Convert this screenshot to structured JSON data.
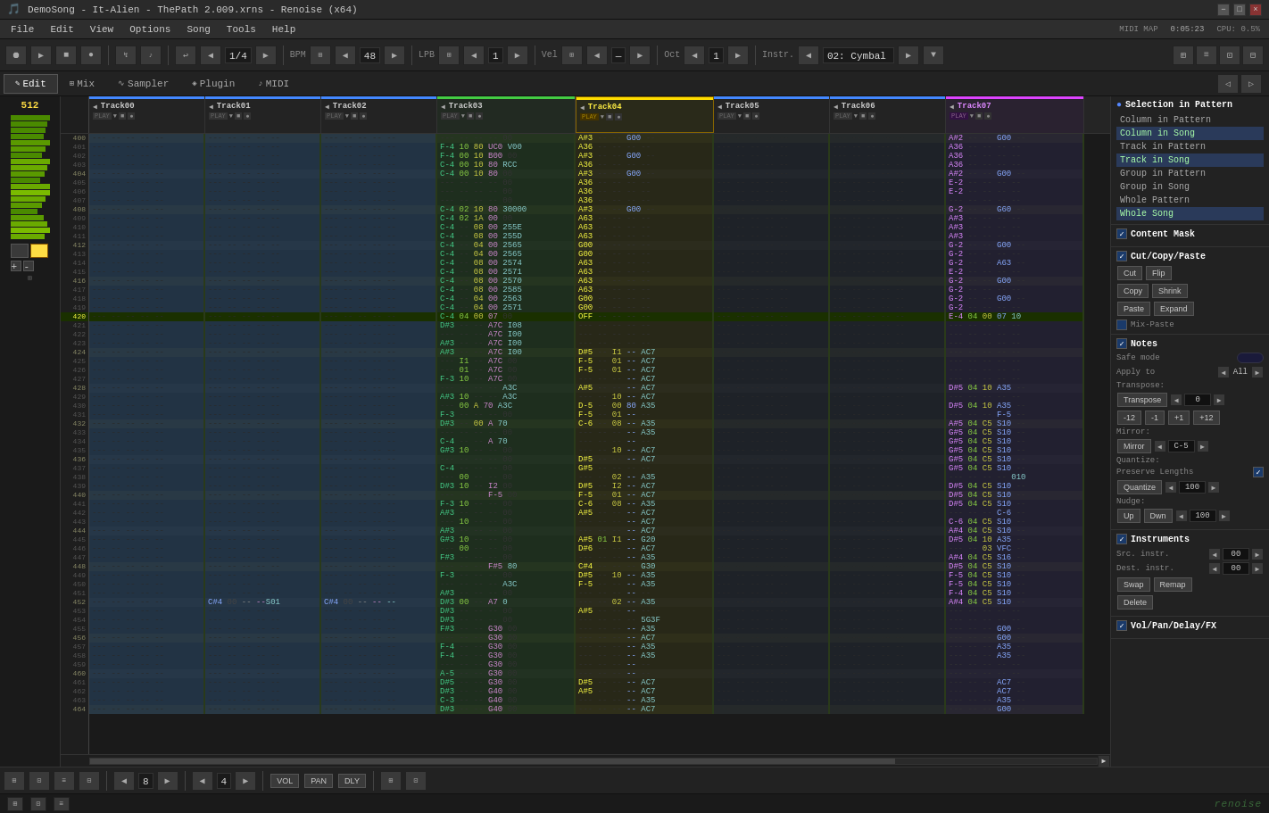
{
  "titlebar": {
    "title": "DemoSong - It-Alien - ThePath 2.009.xrns - Renoise (x64)",
    "min": "−",
    "max": "□",
    "close": "×"
  },
  "menu": {
    "items": [
      "File",
      "Edit",
      "View",
      "Options",
      "Song",
      "Tools",
      "Help"
    ]
  },
  "toolbar": {
    "bpm_label": "BPM",
    "bpm_val": "48",
    "lpb_label": "LPB",
    "lpb_val": "1",
    "vel_label": "Vel",
    "vel_val": "—",
    "oct_label": "Oct",
    "oct_val": "1",
    "instr_label": "Instr.",
    "instr_val": "02: Cymbal",
    "time": "0:05:23",
    "cpu": "CPU: 0.5%",
    "midi": "MIDI MAP",
    "quantize_val": "1/4"
  },
  "tabs": {
    "items": [
      "Edit",
      "Mix",
      "Sampler",
      "Plugin",
      "MIDI"
    ]
  },
  "right_panel": {
    "selection_title": "Selection in Pattern",
    "selection_items": [
      {
        "label": "Column in Pattern",
        "active": false
      },
      {
        "label": "Column in Song",
        "active": true
      },
      {
        "label": "Track in Pattern",
        "active": false
      },
      {
        "label": "Track in Song",
        "active": true
      },
      {
        "label": "Group in Pattern",
        "active": false
      },
      {
        "label": "Group in Song",
        "active": false
      },
      {
        "label": "Whole Pattern",
        "active": false
      },
      {
        "label": "Whole Song",
        "active": true
      }
    ],
    "content_mask_title": "Content Mask",
    "cut_copy_paste_title": "Cut/Copy/Paste",
    "buttons": {
      "cut": "Cut",
      "flip": "Flip",
      "copy": "Copy",
      "shrink": "Shrink",
      "paste": "Paste",
      "expand": "Expand"
    },
    "mix_paste_label": "Mix-Paste",
    "notes_title": "Notes",
    "safe_mode_label": "Safe mode",
    "apply_to_label": "Apply to",
    "apply_to_val": "All",
    "transpose_title": "Transpose:",
    "transpose_val": "0",
    "transpose_btns": [
      "-12",
      "-1",
      "+1",
      "+12"
    ],
    "mirror_title": "Mirror:",
    "mirror_btn": "Mirror",
    "mirror_val": "C-5",
    "quantize_title": "Quantize:",
    "preserve_lengths_label": "Preserve Lengths",
    "quantize_btn": "Quantize",
    "quantize_val": "100",
    "nudge_title": "Nudge:",
    "nudge_up": "Up",
    "nudge_dwn": "Dwn",
    "nudge_val": "100",
    "instruments_title": "Instruments",
    "src_instr_label": "Src. instr.",
    "src_val": "00",
    "dest_instr_label": "Dest. instr.",
    "dest_val": "00",
    "swap_btn": "Swap",
    "remap_btn": "Remap",
    "delete_btn": "Delete",
    "vol_pan_title": "Vol/Pan/Delay/FX"
  },
  "pattern": {
    "number": "512",
    "tracks": [
      {
        "name": "Track00",
        "color": "#4488ff"
      },
      {
        "name": "Track01",
        "color": "#4488ff"
      },
      {
        "name": "Track02",
        "color": "#4488ff"
      },
      {
        "name": "Track03",
        "color": "#44cc44"
      },
      {
        "name": "Track04",
        "color": "#ffdd00"
      },
      {
        "name": "Track05",
        "color": "#4488ff"
      },
      {
        "name": "Track06",
        "color": "#4488ff"
      },
      {
        "name": "Track07",
        "color": "#dd44ff"
      }
    ],
    "row_start": 400,
    "row_end": 464
  },
  "bottom": {
    "loop_label": "8",
    "steps_label": "4",
    "buttons": [
      "VOL",
      "PAN",
      "DLY"
    ]
  },
  "status": {
    "left": "",
    "right": "renoise"
  }
}
